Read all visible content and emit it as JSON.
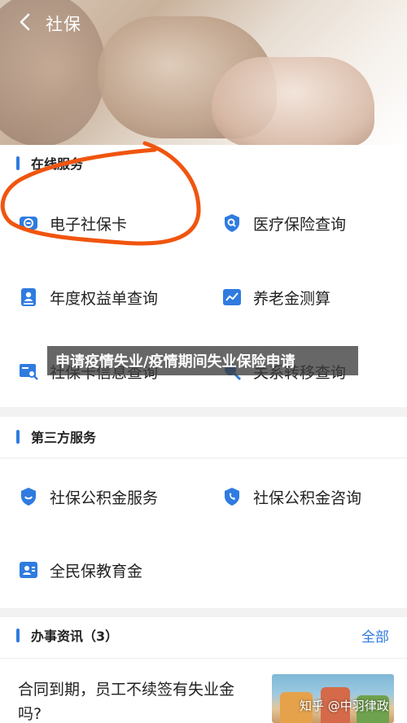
{
  "header": {
    "title": "社保"
  },
  "online_services": {
    "title": "在线服务",
    "items": [
      {
        "label": "电子社保卡",
        "icon": "social-card-icon"
      },
      {
        "label": "医疗保险查询",
        "icon": "shield-search-icon"
      },
      {
        "label": "年度权益单查询",
        "icon": "person-doc-icon"
      },
      {
        "label": "养老金测算",
        "icon": "chart-icon"
      },
      {
        "label": "社保卡信息查询",
        "icon": "card-search-icon"
      },
      {
        "label": "关系转移查询",
        "icon": "transfer-search-icon"
      }
    ]
  },
  "overlay_caption": "申请疫情失业/疫情期间失业保险申请",
  "third_party": {
    "title": "第三方服务",
    "items": [
      {
        "label": "社保公积金服务",
        "icon": "shield-smile-icon"
      },
      {
        "label": "社保公积金咨询",
        "icon": "shield-phone-icon"
      },
      {
        "label": "全民保教育金",
        "icon": "person-card-icon"
      }
    ]
  },
  "news": {
    "title": "办事资讯（3）",
    "more_label": "全部",
    "items": [
      {
        "title": "合同到期，员工不续签有失业金吗?"
      }
    ]
  },
  "watermark": "知乎 @中羽律政",
  "colors": {
    "accent": "#2f7be0",
    "annotation": "#f0550f"
  }
}
